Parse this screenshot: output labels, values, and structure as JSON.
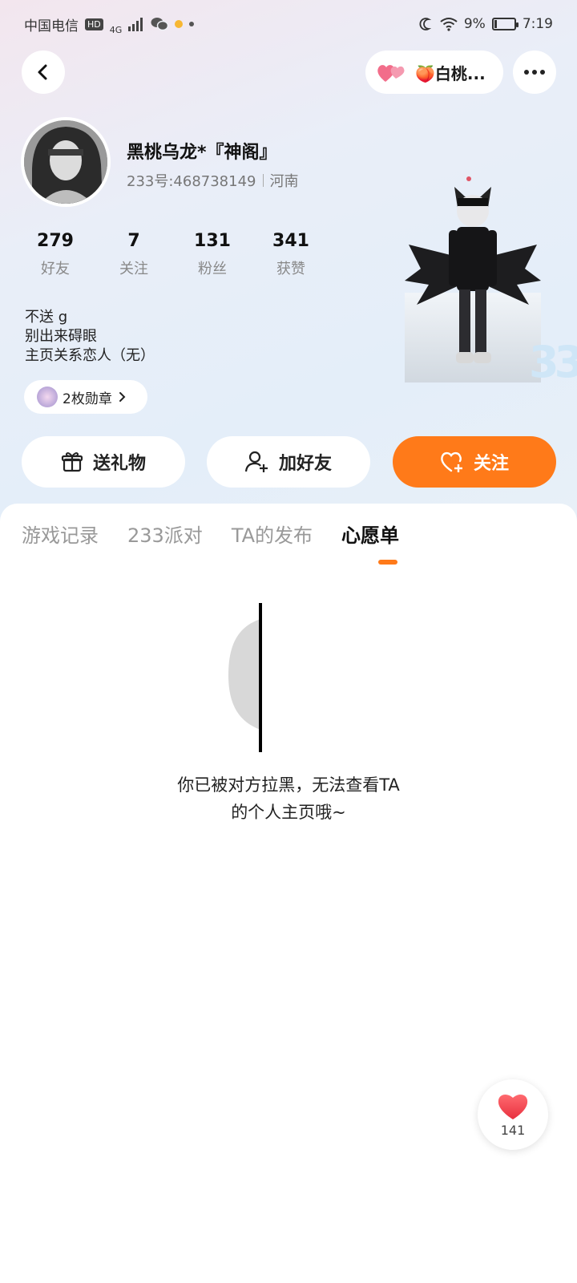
{
  "status_bar": {
    "carrier": "中国电信",
    "hd": "HD",
    "network": "4G",
    "battery": "9%",
    "time": "7:19"
  },
  "top_nav": {
    "peach_label": "🍑白桃..."
  },
  "profile": {
    "nickname": "黑桃乌龙*『神阁』",
    "id_text": "233号:468738149",
    "location": "河南",
    "stats": [
      {
        "num": "279",
        "label": "好友"
      },
      {
        "num": "7",
        "label": "关注"
      },
      {
        "num": "131",
        "label": "粉丝"
      },
      {
        "num": "341",
        "label": "获赞"
      }
    ],
    "bio_lines": [
      "不送 g",
      "别出来碍眼",
      "主页关系恋人（无）"
    ],
    "medal_text": "2枚勋章"
  },
  "actions": {
    "gift": "送礼物",
    "add_friend": "加好友",
    "follow": "关注"
  },
  "tabs": [
    {
      "label": "游戏记录",
      "active": false
    },
    {
      "label": "233派对",
      "active": false
    },
    {
      "label": "TA的发布",
      "active": false
    },
    {
      "label": "心愿单",
      "active": true
    }
  ],
  "blocked": {
    "line1": "你已被对方拉黑，无法查看TA",
    "line2": "的个人主页哦~"
  },
  "like_fab": {
    "count": "141"
  },
  "colors": {
    "accent": "#ff7a19",
    "heart": "#f0505a"
  }
}
